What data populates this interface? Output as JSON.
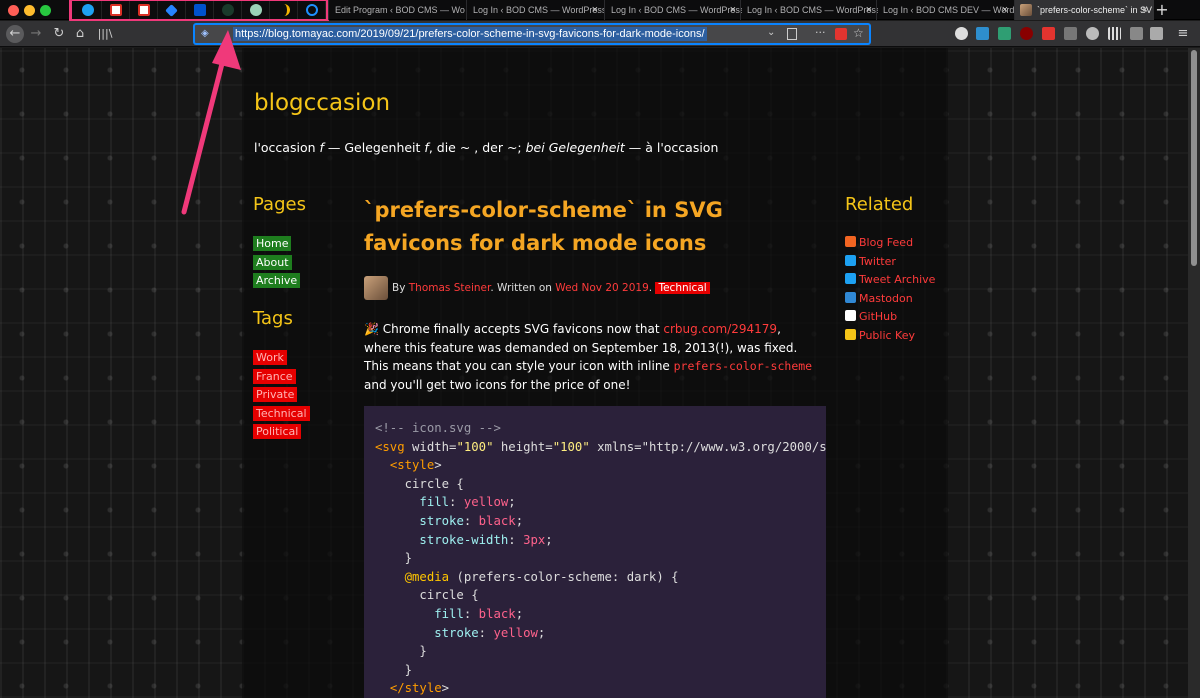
{
  "browser": {
    "tabs": [
      {
        "label": "Edit Program ‹ BOD CMS — Wo"
      },
      {
        "label": "Log In ‹ BOD CMS — WordPress"
      },
      {
        "label": "Log In ‹ BOD CMS — WordPress"
      },
      {
        "label": "Log In ‹ BOD CMS — WordPress"
      },
      {
        "label": "Log In ‹ BOD CMS DEV — Word"
      },
      {
        "label": "`prefers-color-scheme` in SV"
      }
    ],
    "close_glyph": "×",
    "new_tab_glyph": "+",
    "url": "https://blog.tomayac.com/2019/09/21/prefers-color-scheme-in-svg-favicons-for-dark-mode-icons/",
    "more_glyph": "···"
  },
  "site": {
    "title": "blogccasion",
    "tagline_html": "l'occasion <i>f</i> — Gelegenheit <i>f</i>, die ~ , der ~; <i>bei Gelegenheit</i> — à l'occasion"
  },
  "sidebar": {
    "pages_heading": "Pages",
    "pages": [
      "Home",
      "About",
      "Archive"
    ],
    "tags_heading": "Tags",
    "tags": [
      "Work",
      "France",
      "Private",
      "Technical",
      "Political"
    ]
  },
  "post": {
    "title": "`prefers-color-scheme` in SVG favicons for dark mode icons",
    "by": "By",
    "author": "Thomas Steiner",
    "written_on": ". Written on",
    "date": "Wed Nov 20 2019",
    "tag": "Technical",
    "intro_html": "🎉 Chrome finally accepts SVG favicons now that <span class=\"red\">crbug.com/294179</span>, where this feature was demanded on September 18, 2013(!), was fixed. This means that you can style your icon with inline <code>prefers-color-scheme</code> and you'll get two icons for the price of one!",
    "code_lines": [
      "<!-- icon.svg -->",
      "<svg width=\"100\" height=\"100\" xmlns=\"http://www.w3.org/2000/s",
      "  <style>",
      "    circle {",
      "      fill: yellow;",
      "      stroke: black;",
      "      stroke-width: 3px;",
      "    }",
      "    @media (prefers-color-scheme: dark) {",
      "      circle {",
      "        fill: black;",
      "        stroke: yellow;",
      "      }",
      "    }",
      "  </style>"
    ]
  },
  "related": {
    "heading": "Related",
    "links": [
      {
        "label": "Blog Feed",
        "icon": "rss-icon",
        "color": "#f26522"
      },
      {
        "label": "Twitter",
        "icon": "twitter-icon",
        "color": "#1da1f2"
      },
      {
        "label": "Tweet Archive",
        "icon": "twitter-icon",
        "color": "#1da1f2"
      },
      {
        "label": "Mastodon",
        "icon": "mastodon-icon",
        "color": "#3088d4"
      },
      {
        "label": "GitHub",
        "icon": "github-icon",
        "color": "#ffffff"
      },
      {
        "label": "Public Key",
        "icon": "lock-icon",
        "color": "#f5c518"
      }
    ]
  },
  "colors": {
    "site_title": "#f5c518",
    "post_title": "#f5a623",
    "link": "#ff3b3b",
    "page_badge": "#1e7d1e",
    "tag_badge": "#e60000",
    "code_bg": "#2b213a",
    "highlight_annotation": "#f0397a"
  }
}
